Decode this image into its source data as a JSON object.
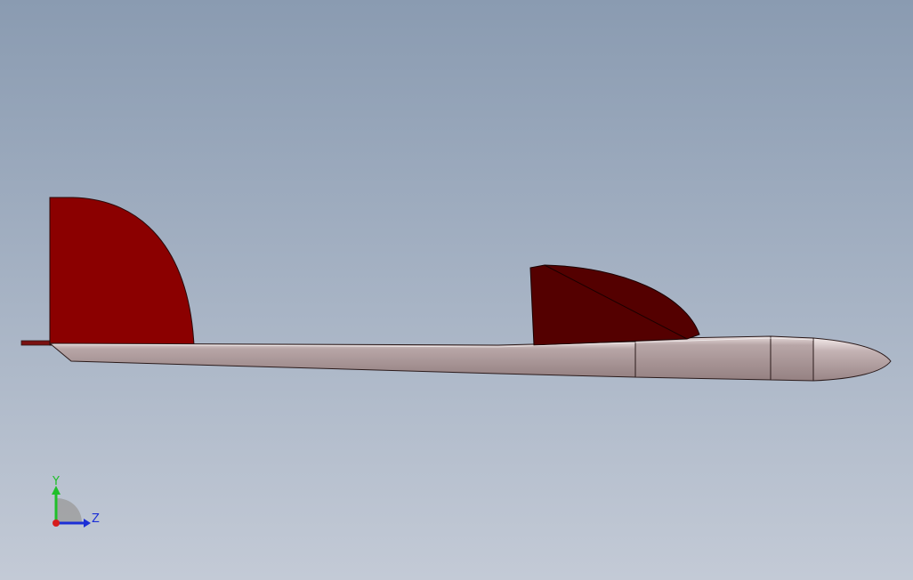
{
  "viewport": {
    "background_top": "#8a9bb1",
    "background_bottom": "#c3cad6"
  },
  "model": {
    "fin_color": "#8b0000",
    "wing_color": "#540000",
    "fuselage_color": "#9c8889",
    "fuselage_highlight": "#d9cccd",
    "edge_color": "#2a1a1a"
  },
  "triad": {
    "y_label": "Y",
    "z_label": "Z",
    "y_color": "#1fbf2a",
    "z_color": "#1c2fd6",
    "x_color": "#d61c1c"
  }
}
